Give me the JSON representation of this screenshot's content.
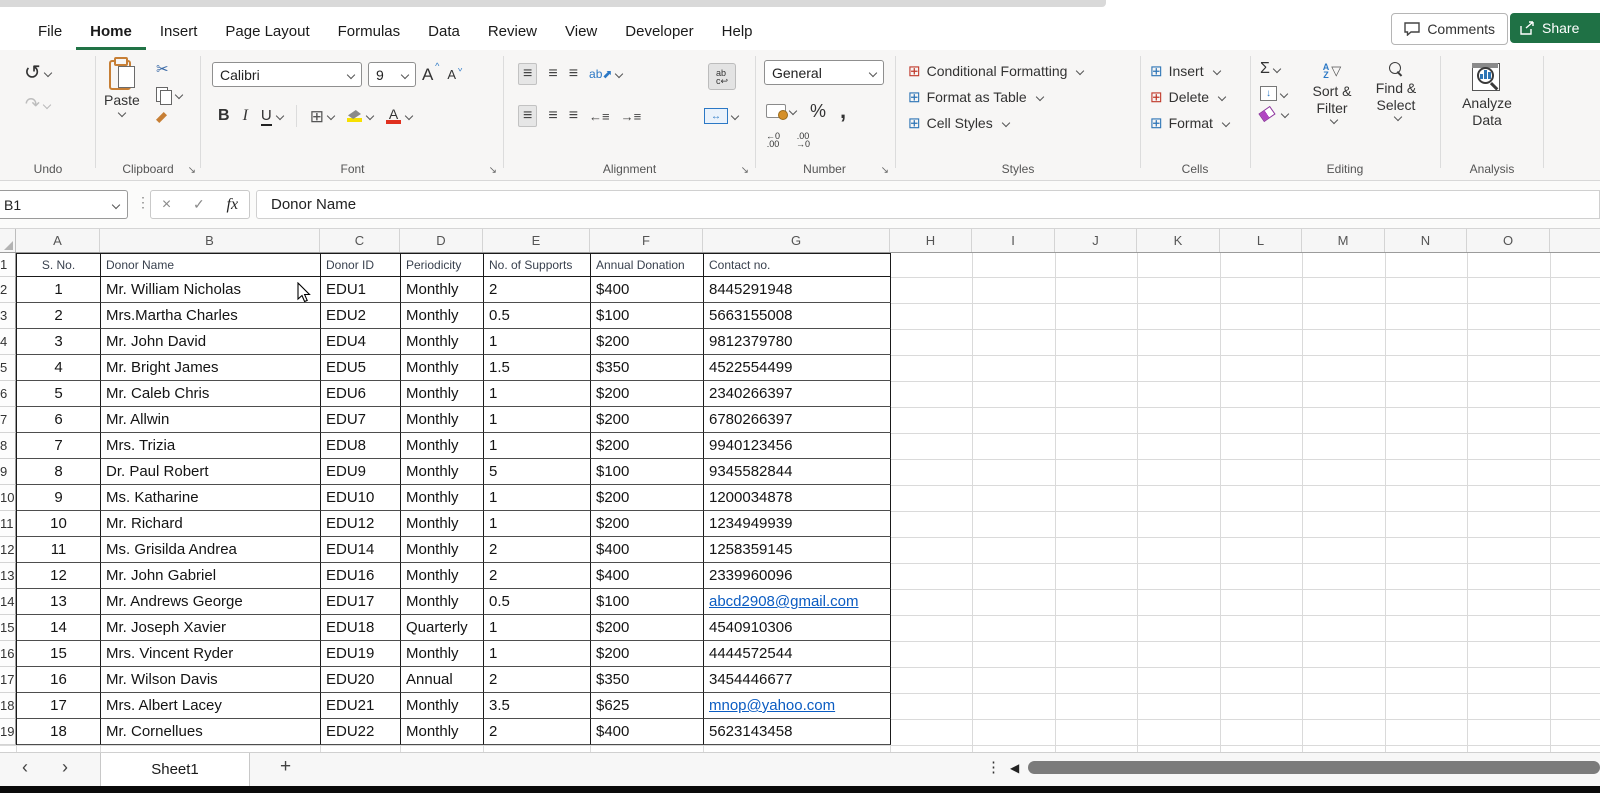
{
  "window": {
    "comments": "Comments",
    "share": "Share"
  },
  "menu": {
    "tabs": [
      "File",
      "Home",
      "Insert",
      "Page Layout",
      "Formulas",
      "Data",
      "Review",
      "View",
      "Developer",
      "Help"
    ],
    "active_tab": "Home"
  },
  "ribbon": {
    "undo": {
      "label": "Undo"
    },
    "clipboard": {
      "label": "Clipboard",
      "paste": "Paste"
    },
    "font": {
      "label": "Font",
      "family": "Calibri",
      "size": "9",
      "bold": "B",
      "italic": "I",
      "underline": "U"
    },
    "alignment": {
      "label": "Alignment"
    },
    "number": {
      "label": "Number",
      "format": "General",
      "percent": "%",
      "comma": ","
    },
    "styles": {
      "label": "Styles",
      "items": [
        "Conditional Formatting",
        "Format as Table",
        "Cell Styles"
      ]
    },
    "cells": {
      "label": "Cells",
      "items": [
        "Insert",
        "Delete",
        "Format"
      ]
    },
    "editing": {
      "label": "Editing",
      "autosum": "Σ",
      "sort_filter": "Sort & Filter",
      "find_select": "Find & Select"
    },
    "analysis": {
      "label": "Analysis",
      "button": "Analyze Data"
    }
  },
  "formula_bar": {
    "name_box": "B1",
    "cancel": "×",
    "enter": "✓",
    "fx": "fx",
    "value": "Donor Name"
  },
  "grid": {
    "columns": [
      "A",
      "B",
      "C",
      "D",
      "E",
      "F",
      "G",
      "H",
      "I",
      "J",
      "K",
      "L",
      "M",
      "N",
      "O"
    ],
    "row_numbers": [
      "1",
      "2",
      "3",
      "4",
      "5",
      "6",
      "7",
      "8",
      "9",
      "10",
      "11",
      "12",
      "13",
      "14",
      "15",
      "16",
      "17",
      "18",
      "19"
    ],
    "header_row": [
      "S. No.",
      "Donor Name",
      "Donor ID",
      "Periodicity",
      "No. of Supports",
      "Annual Donation",
      "Contact no."
    ],
    "rows": [
      {
        "cells": [
          "1",
          "Mr. William Nicholas",
          "EDU1",
          "Monthly",
          "2",
          "$400",
          "8445291948"
        ],
        "link": false
      },
      {
        "cells": [
          "2",
          "Mrs.Martha Charles",
          "EDU2",
          "Monthly",
          "0.5",
          "$100",
          "5663155008"
        ],
        "link": false
      },
      {
        "cells": [
          "3",
          "Mr. John David",
          "EDU4",
          "Monthly",
          "1",
          "$200",
          "9812379780"
        ],
        "link": false
      },
      {
        "cells": [
          "4",
          "Mr. Bright James",
          "EDU5",
          "Monthly",
          "1.5",
          "$350",
          "4522554499"
        ],
        "link": false
      },
      {
        "cells": [
          "5",
          "Mr. Caleb Chris",
          "EDU6",
          "Monthly",
          "1",
          "$200",
          "2340266397"
        ],
        "link": false
      },
      {
        "cells": [
          "6",
          "Mr. Allwin",
          "EDU7",
          "Monthly",
          "1",
          "$200",
          "6780266397"
        ],
        "link": false
      },
      {
        "cells": [
          "7",
          "Mrs. Trizia",
          "EDU8",
          "Monthly",
          "1",
          "$200",
          "9940123456"
        ],
        "link": false
      },
      {
        "cells": [
          "8",
          "Dr. Paul Robert",
          "EDU9",
          "Monthly",
          "5",
          "$100",
          "9345582844"
        ],
        "link": false
      },
      {
        "cells": [
          "9",
          "Ms. Katharine",
          "EDU10",
          "Monthly",
          "1",
          "$200",
          "1200034878"
        ],
        "link": false
      },
      {
        "cells": [
          "10",
          "Mr. Richard",
          "EDU12",
          "Monthly",
          "1",
          "$200",
          "1234949939"
        ],
        "link": false
      },
      {
        "cells": [
          "11",
          "Ms. Grisilda Andrea",
          "EDU14",
          "Monthly",
          "2",
          "$400",
          "1258359145"
        ],
        "link": false
      },
      {
        "cells": [
          "12",
          "Mr. John Gabriel",
          "EDU16",
          "Monthly",
          "2",
          "$400",
          "2339960096"
        ],
        "link": false
      },
      {
        "cells": [
          "13",
          "Mr. Andrews George",
          "EDU17",
          "Monthly",
          "0.5",
          "$100",
          "abcd2908@gmail.com"
        ],
        "link": true
      },
      {
        "cells": [
          "14",
          "Mr. Joseph Xavier",
          "EDU18",
          "Quarterly",
          "1",
          "$200",
          "4540910306"
        ],
        "link": false
      },
      {
        "cells": [
          "15",
          "Mrs. Vincent Ryder",
          "EDU19",
          "Monthly",
          "1",
          "$200",
          "4444572544"
        ],
        "link": false
      },
      {
        "cells": [
          "16",
          "Mr. Wilson Davis",
          "EDU20",
          "Annual",
          "2",
          "$350",
          "3454446677"
        ],
        "link": false
      },
      {
        "cells": [
          "17",
          "Mrs. Albert Lacey",
          "EDU21",
          "Monthly",
          "3.5",
          "$625",
          "mnop@yahoo.com"
        ],
        "link": true
      },
      {
        "cells": [
          "18",
          "Mr. Cornellues",
          "EDU22",
          "Monthly",
          "2",
          "$400",
          "5623143458"
        ],
        "link": false
      }
    ]
  },
  "sheet_bar": {
    "prev": "‹",
    "next": "›",
    "sheet": "Sheet1",
    "add": "+",
    "dots": "⋮",
    "scroll_left": "◀"
  },
  "colors": {
    "accent_green": "#217346",
    "link_blue": "#0b5cc2",
    "fill_yellow": "#f7e000",
    "font_red": "#e0301e"
  }
}
